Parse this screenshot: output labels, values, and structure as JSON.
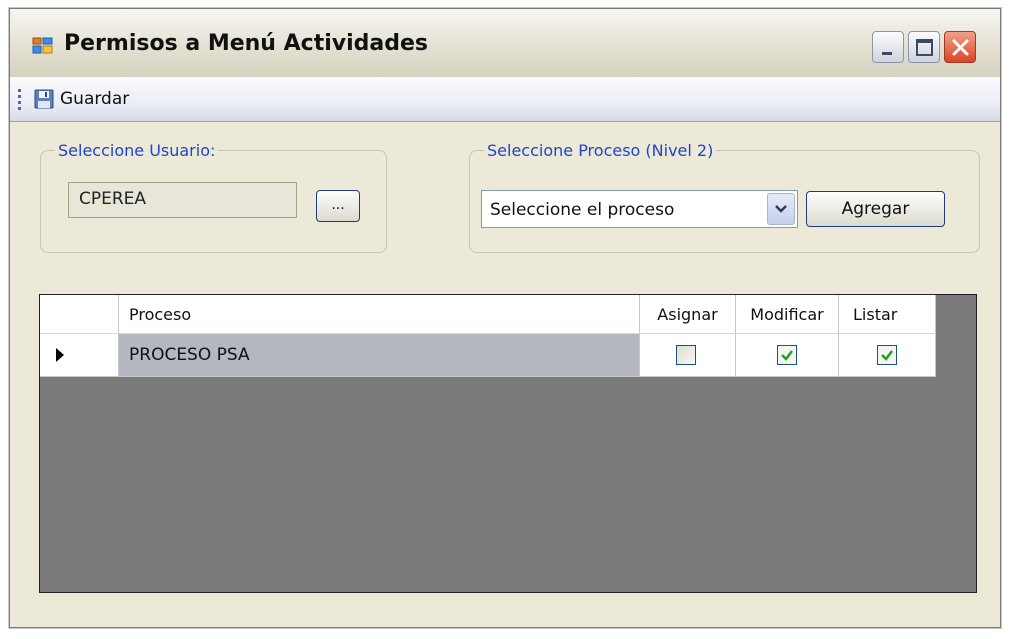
{
  "window": {
    "title": "Permisos a Menú Actividades"
  },
  "toolbar": {
    "save_label": "Guardar"
  },
  "user_group": {
    "legend": "Seleccione Usuario:",
    "value": "CPEREA",
    "browse_label": "..."
  },
  "process_group": {
    "legend": "Seleccione Proceso (Nivel 2)",
    "combo_value": "Seleccione el proceso",
    "add_label": "Agregar"
  },
  "grid": {
    "columns": [
      "Proceso",
      "Asignar",
      "Modificar",
      "Listar"
    ],
    "rows": [
      {
        "proceso": "PROCESO PSA",
        "asignar": false,
        "modificar": true,
        "listar": true
      }
    ]
  },
  "colors": {
    "legend": "#1e46c8",
    "grid_background": "#7a7a7a",
    "check": "#21a121"
  }
}
